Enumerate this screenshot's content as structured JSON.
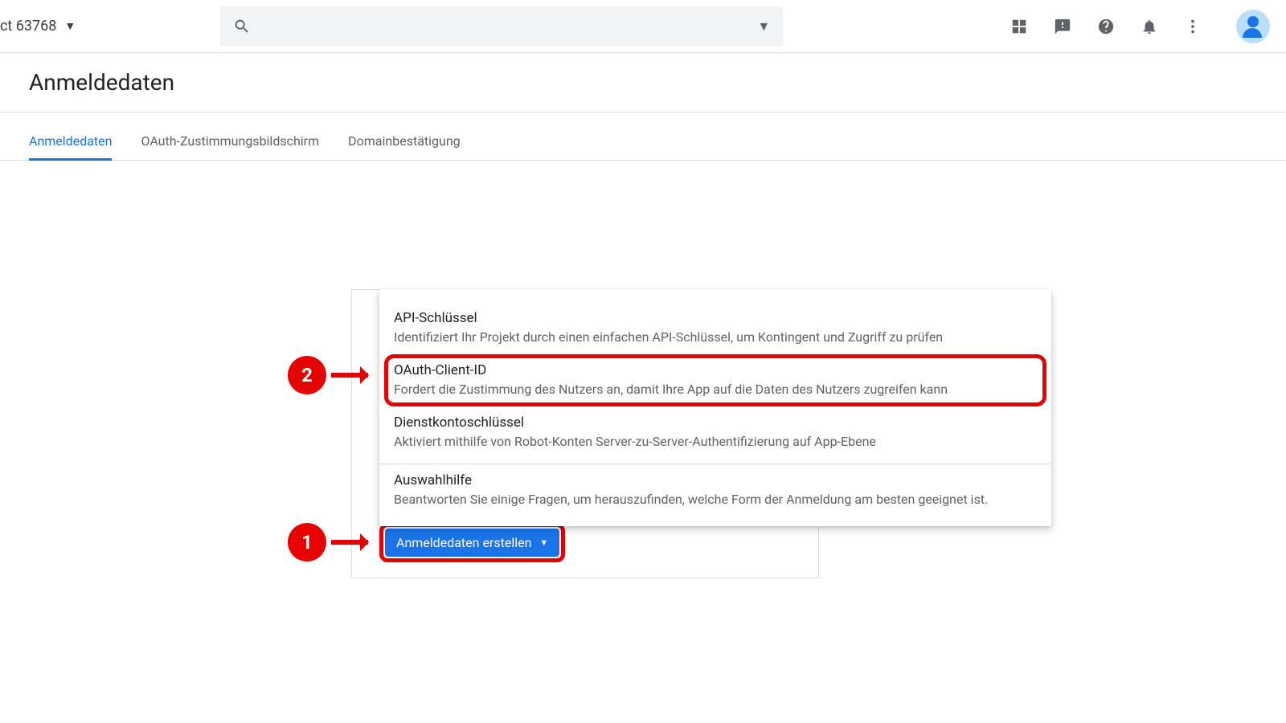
{
  "header": {
    "project_label": "ct 63768"
  },
  "page": {
    "title": "Anmeldedaten"
  },
  "tabs": [
    {
      "label": "Anmeldedaten",
      "active": true
    },
    {
      "label": "OAuth-Zustimmungsbildschirm",
      "active": false
    },
    {
      "label": "Domainbestätigung",
      "active": false
    }
  ],
  "create_button": {
    "label": "Anmeldedaten erstellen"
  },
  "popup": {
    "items": [
      {
        "title": "API-Schlüssel",
        "desc": "Identifiziert Ihr Projekt durch einen einfachen API-Schlüssel, um Kontingent und Zugriff zu prüfen",
        "highlighted": false
      },
      {
        "title": "OAuth-Client-ID",
        "desc": "Fordert die Zustimmung des Nutzers an, damit Ihre App auf die Daten des Nutzers zugreifen kann",
        "highlighted": true
      },
      {
        "title": "Dienstkontoschlüssel",
        "desc": "Aktiviert mithilfe von Robot-Konten Server-zu-Server-Authentifizierung auf App-Ebene",
        "highlighted": false
      }
    ],
    "help": {
      "title": "Auswahlhilfe",
      "desc": "Beantworten Sie einige Fragen, um herauszufinden, welche Form der Anmeldung am besten geeignet ist."
    }
  },
  "annotations": {
    "step1": "1",
    "step2": "2"
  }
}
